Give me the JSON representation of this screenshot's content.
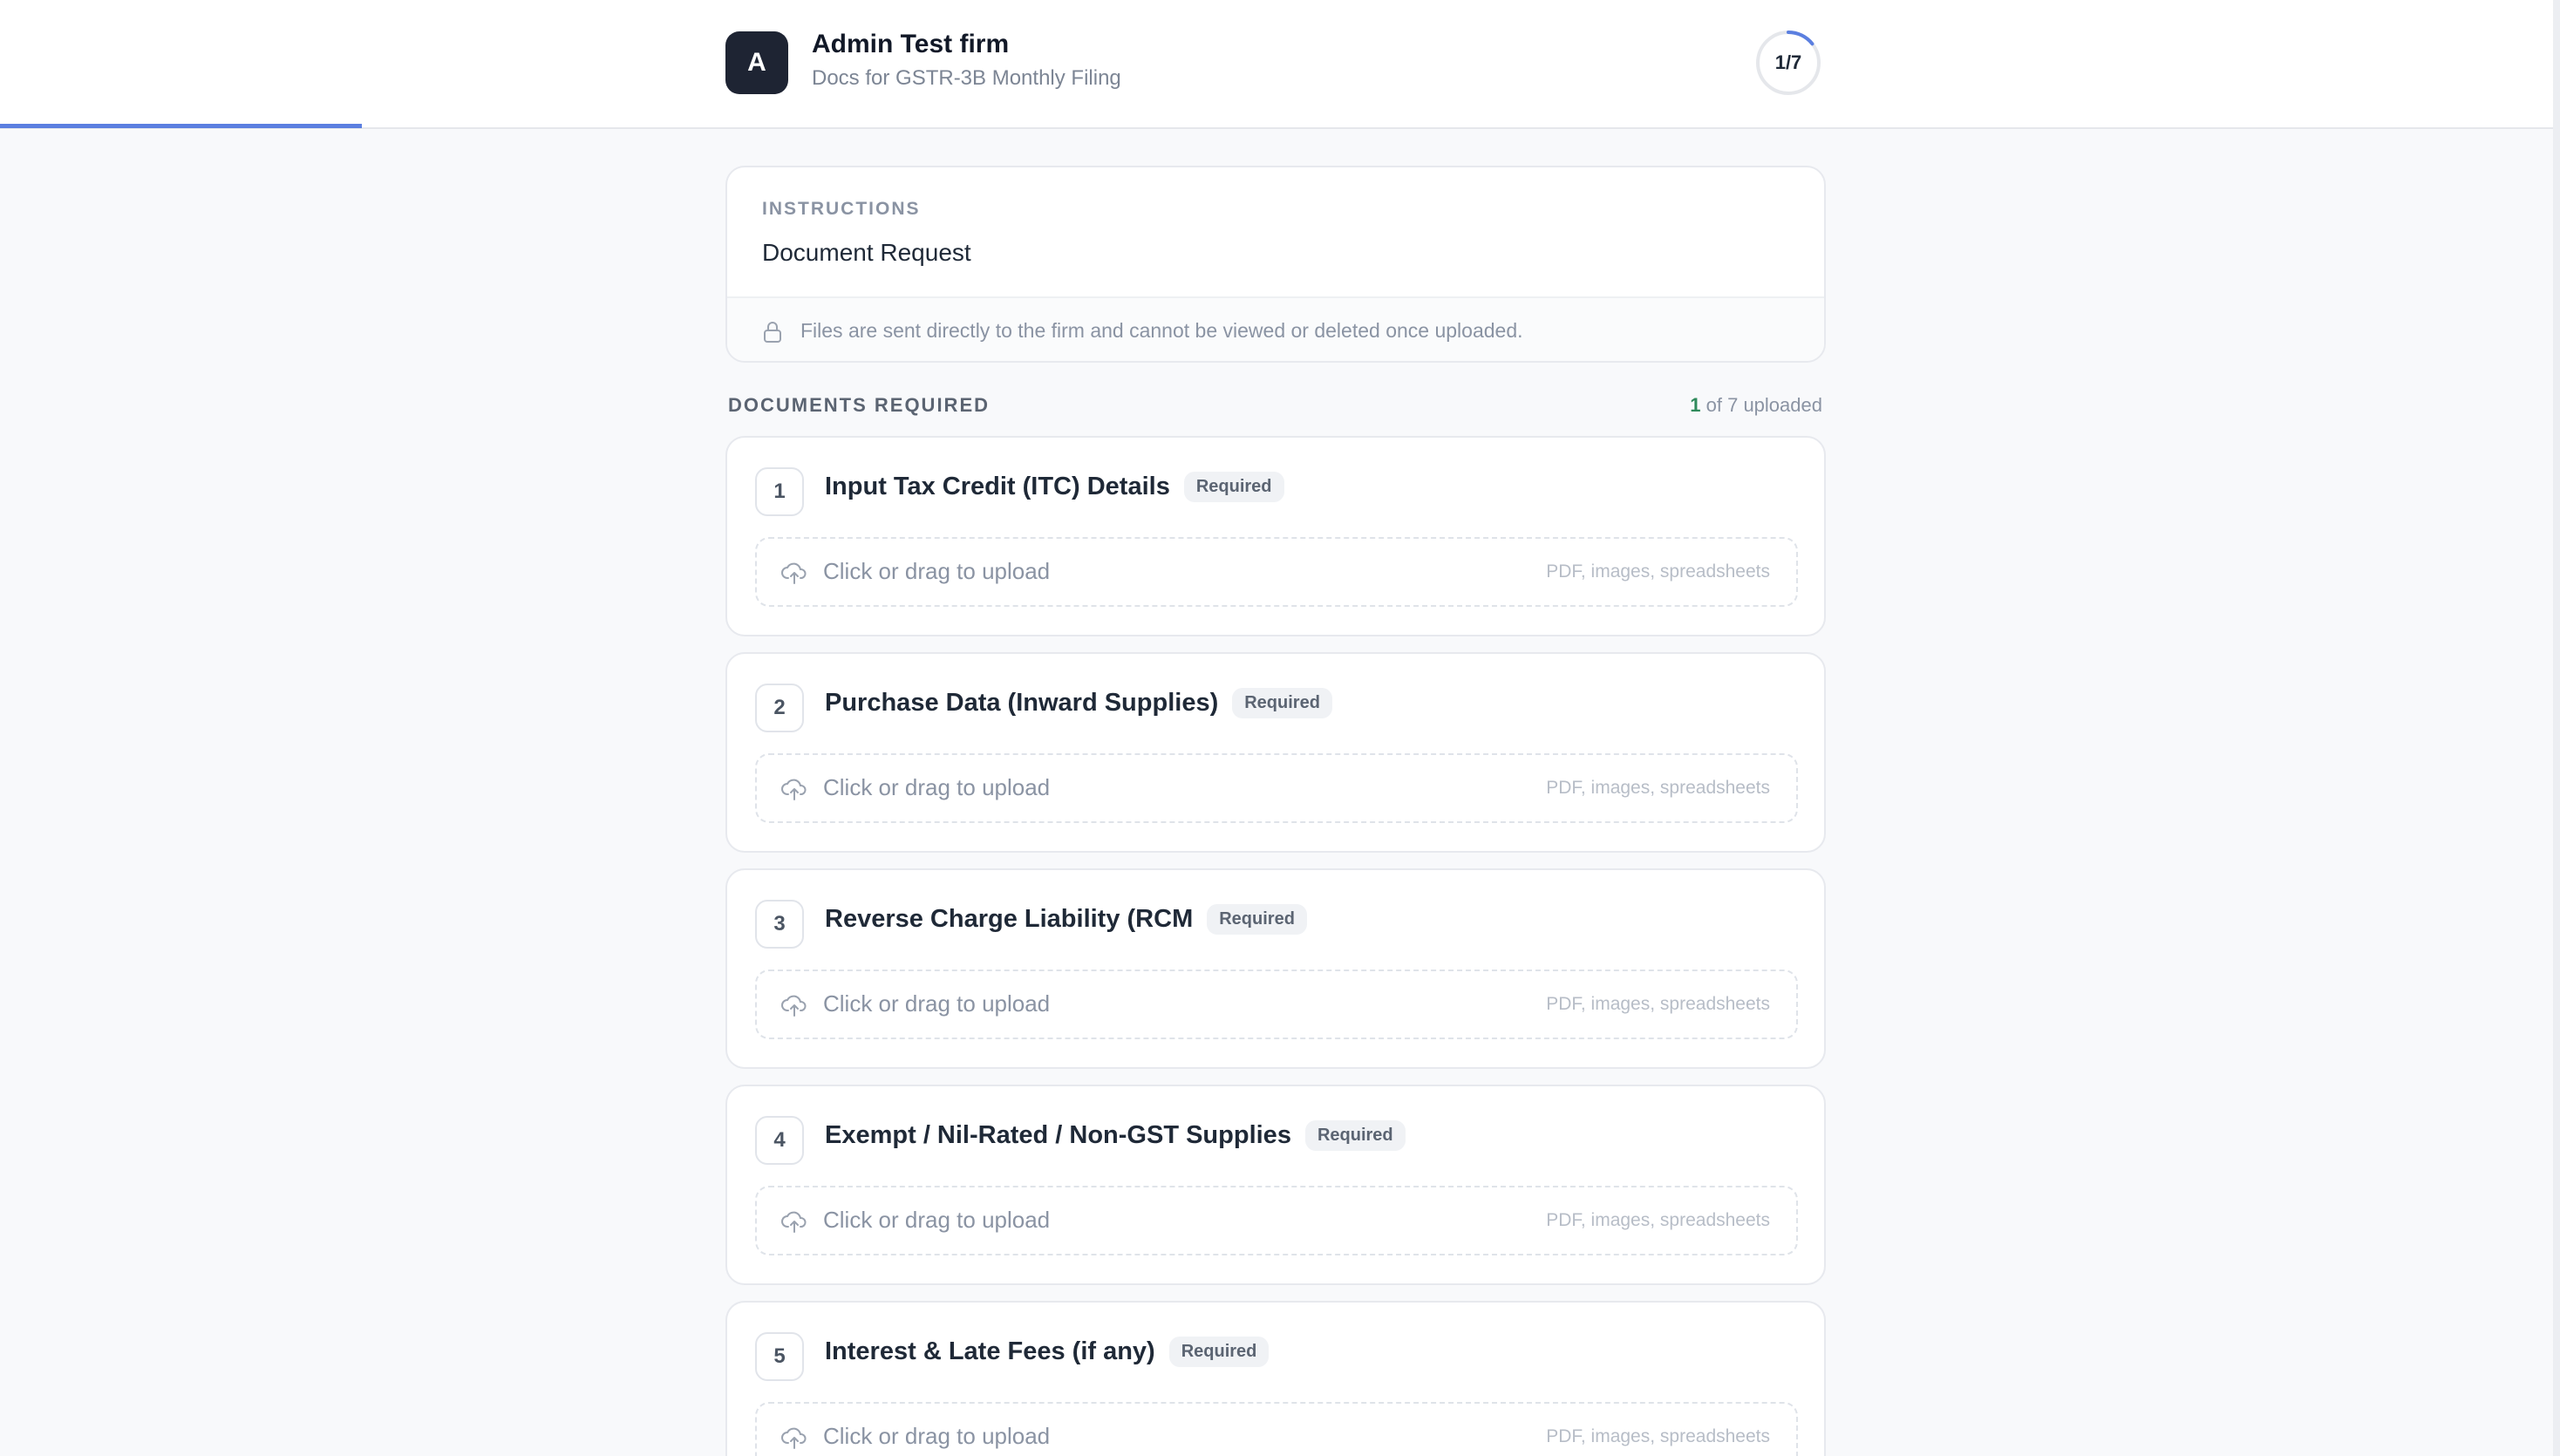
{
  "header": {
    "avatar_letter": "A",
    "firm_name": "Admin Test firm",
    "subtitle": "Docs for GSTR-3B Monthly Filing",
    "progress_label": "1/7",
    "progress_fraction": 0.143,
    "accent_color": "#5b7fe0"
  },
  "instructions": {
    "kicker": "INSTRUCTIONS",
    "title": "Document Request",
    "note": "Files are sent directly to the firm and cannot be viewed or deleted once uploaded."
  },
  "documents": {
    "heading": "DOCUMENTS REQUIRED",
    "uploaded_count": "1",
    "count_suffix": " of 7 uploaded",
    "items": [
      {
        "num": "1",
        "title": "Input Tax Credit (ITC) Details",
        "badge": "Required",
        "upload_label": "Click or drag to upload",
        "hint": "PDF, images, spreadsheets"
      },
      {
        "num": "2",
        "title": "Purchase Data (Inward Supplies)",
        "badge": "Required",
        "upload_label": "Click or drag to upload",
        "hint": "PDF, images, spreadsheets"
      },
      {
        "num": "3",
        "title": "Reverse Charge Liability (RCM",
        "badge": "Required",
        "upload_label": "Click or drag to upload",
        "hint": "PDF, images, spreadsheets"
      },
      {
        "num": "4",
        "title": "Exempt / Nil-Rated / Non-GST Supplies",
        "badge": "Required",
        "upload_label": "Click or drag to upload",
        "hint": "PDF, images, spreadsheets"
      },
      {
        "num": "5",
        "title": "Interest & Late Fees (if any)",
        "badge": "Required",
        "upload_label": "Click or drag to upload",
        "hint": "PDF, images, spreadsheets"
      }
    ]
  }
}
